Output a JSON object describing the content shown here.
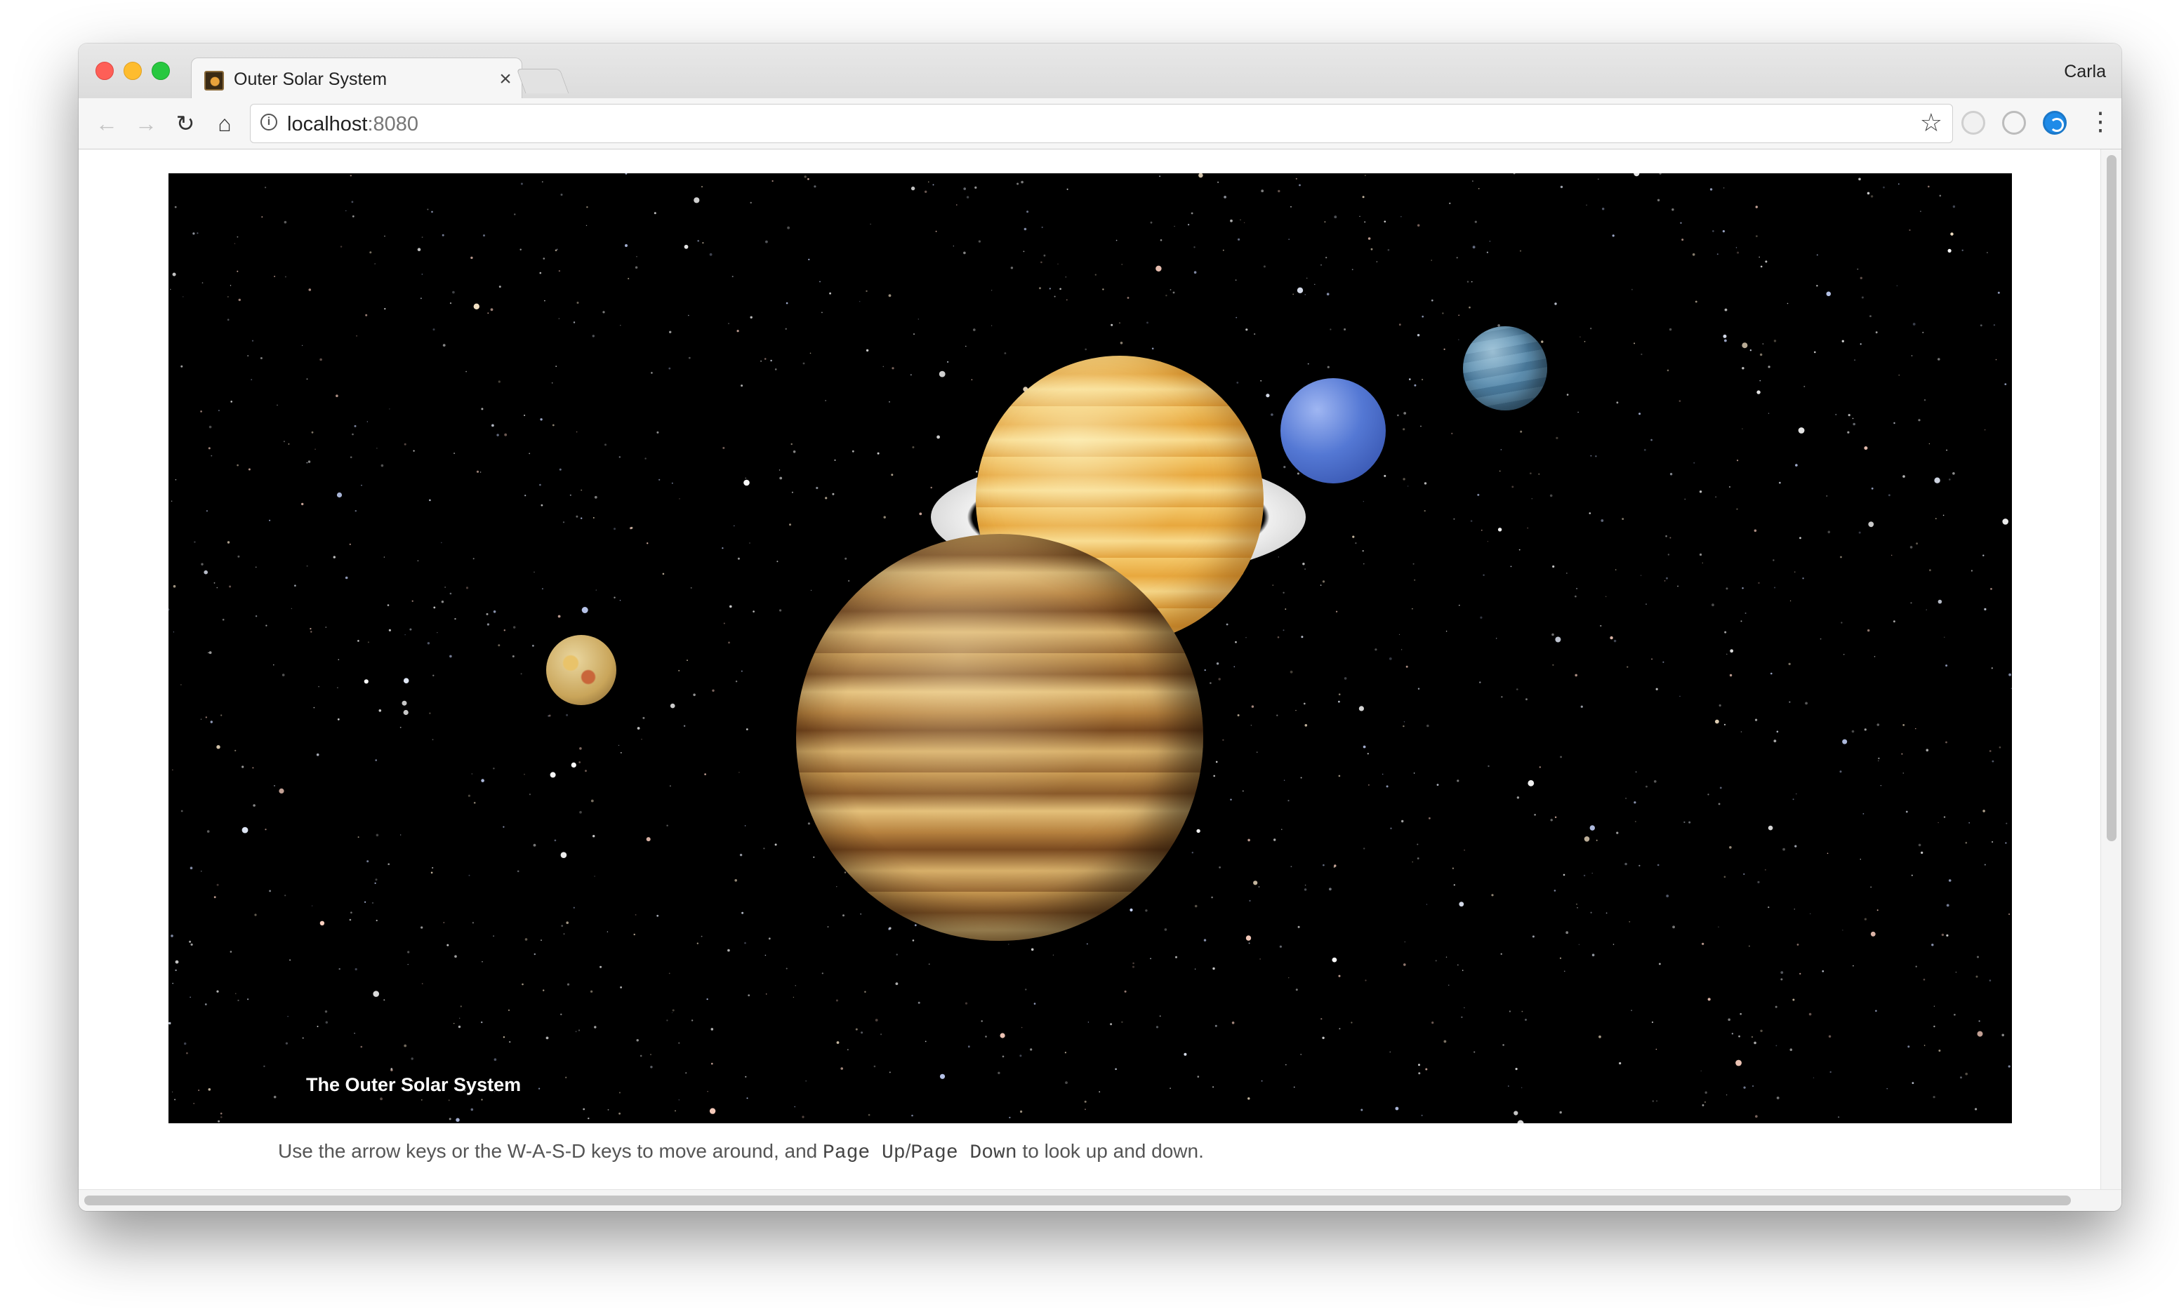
{
  "browser": {
    "tab": {
      "title": "Outer Solar System",
      "close_icon": "×"
    },
    "profile_name": "Carla",
    "toolbar": {
      "back_icon": "←",
      "forward_icon": "→",
      "reload_icon": "↻",
      "home_icon": "⌂",
      "info_icon": "i",
      "url_host": "localhost",
      "url_port": ":8080",
      "star_icon": "☆",
      "menu_icon": "⋮"
    }
  },
  "page": {
    "scene_title": "The Outer Solar System",
    "hint": {
      "prefix": "Use the arrow keys or the W-A-S-D keys to move around, and ",
      "key1": "Page Up",
      "separator": "/",
      "key2": "Page Down",
      "suffix": " to look up and down."
    }
  },
  "colors": {
    "close": "#fe5f57",
    "minimize": "#febc2e",
    "maximize": "#28c840",
    "scene_background": "#000000"
  }
}
